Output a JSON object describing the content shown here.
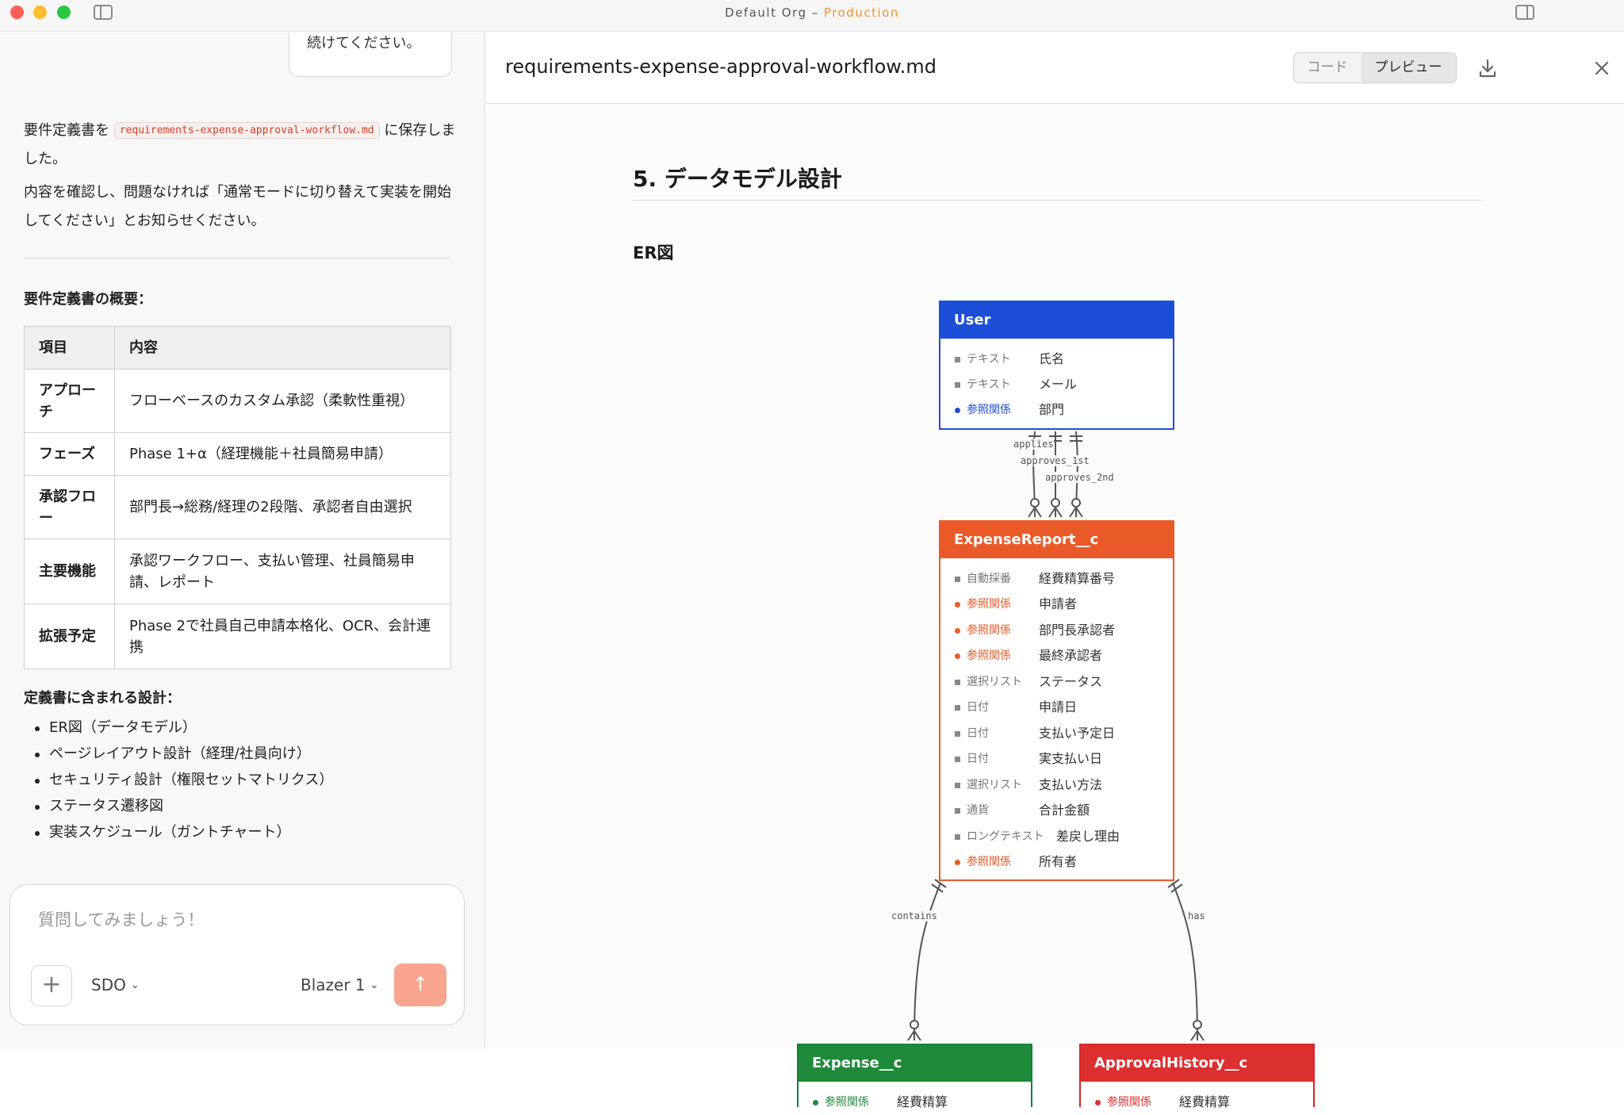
{
  "window": {
    "title_org": "Default Org",
    "title_sep": " – ",
    "title_env": "Production"
  },
  "chat": {
    "prev_bubble_text": "続けてください。",
    "msg_saved_prefix": "要件定義書を",
    "msg_saved_file": "requirements-expense-approval-workflow.md",
    "msg_saved_suffix": "に保存しました。",
    "msg_confirm": "内容を確認し、問題なければ「通常モードに切り替えて実装を開始してください」とお知らせください。",
    "overview_heading": "要件定義書の概要：",
    "table": {
      "headers": [
        "項目",
        "内容"
      ],
      "rows": [
        [
          "アプローチ",
          "フローベースのカスタム承認（柔軟性重視）"
        ],
        [
          "フェーズ",
          "Phase 1+α（経理機能＋社員簡易申請）"
        ],
        [
          "承認フロー",
          "部門長→総務/経理の2段階、承認者自由選択"
        ],
        [
          "主要機能",
          "承認ワークフロー、支払い管理、社員簡易申請、レポート"
        ],
        [
          "拡張予定",
          "Phase 2で社員自己申請本格化、OCR、会計連携"
        ]
      ]
    },
    "design_heading": "定義書に含まれる設計：",
    "design_items": [
      "ER図（データモデル）",
      "ページレイアウト設計（経理/社員向け）",
      "セキュリティ設計（権限セットマトリクス）",
      "ステータス遷移図",
      "実装スケジュール（ガントチャート）"
    ]
  },
  "composer": {
    "placeholder": "質問してみましょう！",
    "plus_label": "+",
    "org_select": "SDO",
    "model_select": "Blazer 1",
    "send_label": "↑"
  },
  "doc": {
    "file_name": "requirements-expense-approval-workflow.md",
    "tab_code": "コード",
    "tab_preview": "プレビュー",
    "active_tab": "プレビュー",
    "section_title": "5. データモデル設計",
    "er_heading": "ER図"
  },
  "er": {
    "entities": {
      "user": {
        "name": "User",
        "color": "#1d4ed8",
        "fields": [
          {
            "type": "テキスト",
            "name": "氏名",
            "fk": false
          },
          {
            "type": "テキスト",
            "name": "メール",
            "fk": false
          },
          {
            "type": "参照関係",
            "name": "部門",
            "fk": true
          }
        ]
      },
      "expense_report": {
        "name": "ExpenseReport__c",
        "color": "#ea5a28",
        "fields": [
          {
            "type": "自動採番",
            "name": "経費精算番号",
            "fk": false
          },
          {
            "type": "参照関係",
            "name": "申請者",
            "fk": true
          },
          {
            "type": "参照関係",
            "name": "部門長承認者",
            "fk": true
          },
          {
            "type": "参照関係",
            "name": "最終承認者",
            "fk": true
          },
          {
            "type": "選択リスト",
            "name": "ステータス",
            "fk": false
          },
          {
            "type": "日付",
            "name": "申請日",
            "fk": false
          },
          {
            "type": "日付",
            "name": "支払い予定日",
            "fk": false
          },
          {
            "type": "日付",
            "name": "実支払い日",
            "fk": false
          },
          {
            "type": "選択リスト",
            "name": "支払い方法",
            "fk": false
          },
          {
            "type": "通貨",
            "name": "合計金額",
            "fk": false
          },
          {
            "type": "ロングテキスト",
            "name": "差戻し理由",
            "fk": false
          },
          {
            "type": "参照関係",
            "name": "所有者",
            "fk": true
          }
        ]
      },
      "expense": {
        "name": "Expense__c",
        "color": "#1f8a3a",
        "fields": [
          {
            "type": "参照関係",
            "name": "経費精算",
            "fk": true
          }
        ]
      },
      "approval_history": {
        "name": "ApprovalHistory__c",
        "color": "#dc2f2f",
        "fields": [
          {
            "type": "参照関係",
            "name": "経費精算",
            "fk": true
          }
        ]
      }
    },
    "relations": {
      "applies": "applies",
      "approves_1st": "approves_1st",
      "approves_2nd": "approves_2nd",
      "contains": "contains",
      "has": "has"
    }
  }
}
